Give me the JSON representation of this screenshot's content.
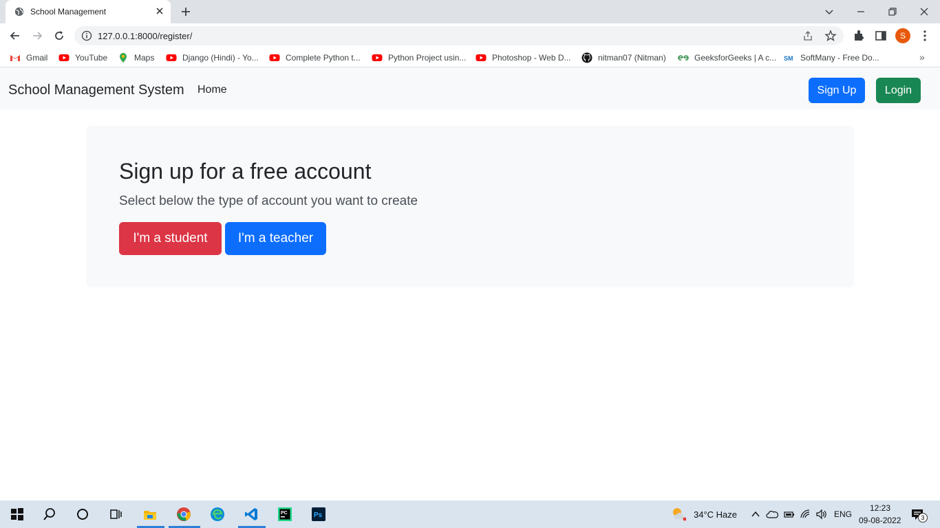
{
  "browser": {
    "tab_title": "School Management",
    "url": "127.0.0.1:8000/register/",
    "profile_initial": "S",
    "bookmarks": [
      {
        "label": "Gmail",
        "icon": "gmail-icon"
      },
      {
        "label": "YouTube",
        "icon": "youtube-icon"
      },
      {
        "label": "Maps",
        "icon": "maps-icon"
      },
      {
        "label": "Django (Hindi) - Yo...",
        "icon": "youtube-icon"
      },
      {
        "label": "Complete Python t...",
        "icon": "youtube-icon"
      },
      {
        "label": "Python Project usin...",
        "icon": "youtube-icon"
      },
      {
        "label": "Photoshop - Web D...",
        "icon": "youtube-icon"
      },
      {
        "label": "nitman07 (Nitman)",
        "icon": "github-icon"
      },
      {
        "label": "GeeksforGeeks | A c...",
        "icon": "geeksforgeeks-icon"
      },
      {
        "label": "SoftMany - Free Do...",
        "icon": "softmany-icon"
      }
    ],
    "bookmarks_more": "»"
  },
  "navbar": {
    "brand": "School Management System",
    "home": "Home",
    "signup": "Sign Up",
    "login": "Login"
  },
  "hero": {
    "title": "Sign up for a free account",
    "lead": "Select below the type of account you want to create",
    "student_button": "I'm a student",
    "teacher_button": "I'm a teacher"
  },
  "taskbar": {
    "weather": "34°C  Haze",
    "language": "ENG",
    "time": "12:23",
    "date": "09-08-2022",
    "notification_count": "3"
  },
  "colors": {
    "primary": "#0d6efd",
    "success": "#198754",
    "danger": "#dc3545",
    "navbar_bg": "#f8f9fa"
  }
}
